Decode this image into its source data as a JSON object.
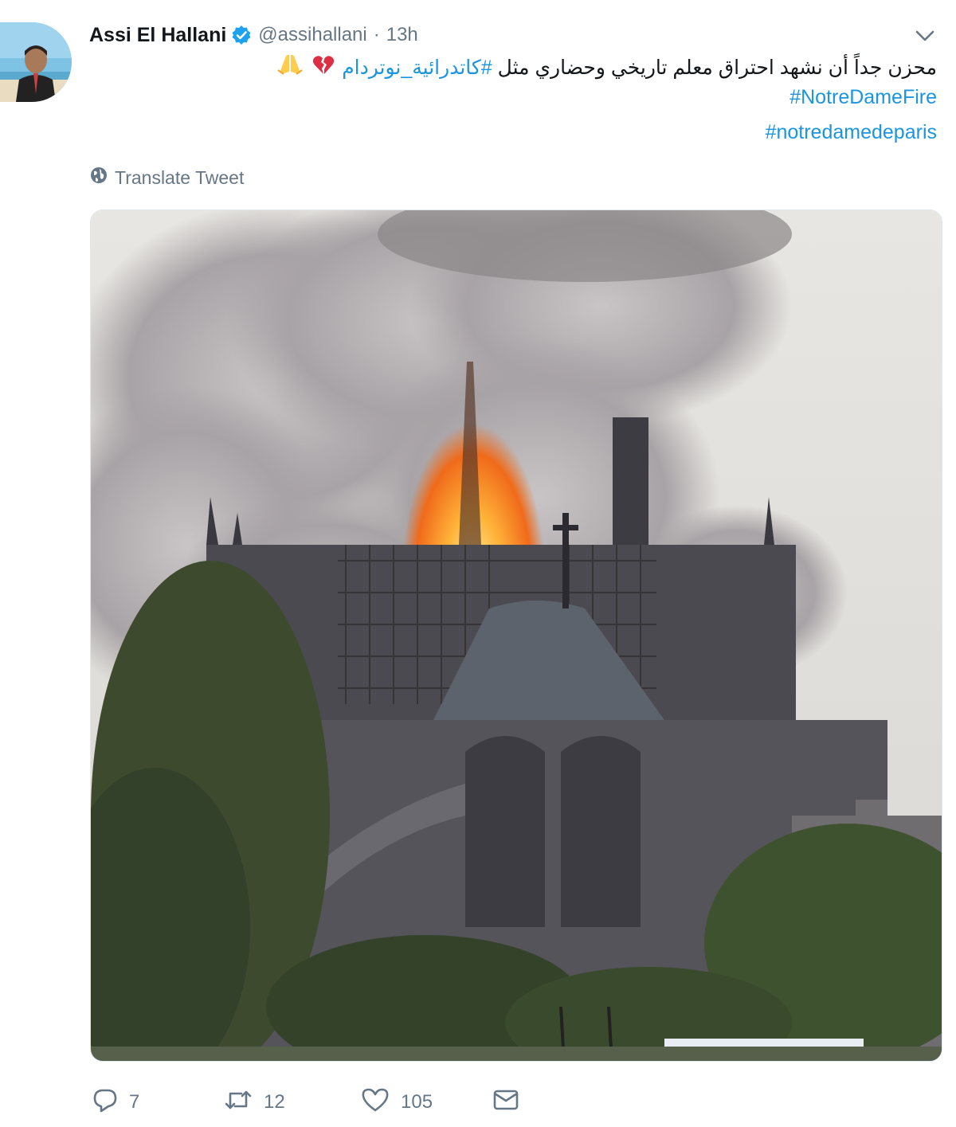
{
  "tweet": {
    "display_name": "Assi El Hallani",
    "verified": true,
    "handle": "@assihallani",
    "separator": "·",
    "time": "13h",
    "text_arabic": "محزن جداً أن نشهد احتراق معلم تاريخي وحضاري مثل",
    "hashtag_arabic": "#كاتدرائية_نوتردام",
    "emojis": [
      "broken-heart-emoji",
      "folded-hands-emoji"
    ],
    "hashtag_1": "#NotreDameFire",
    "hashtag_2": "#notredamedeparis",
    "translate_label": "Translate Tweet",
    "media_description": "photo-notre-dame-fire"
  },
  "actions": {
    "reply_count": "7",
    "retweet_count": "12",
    "like_count": "105"
  },
  "icons": {
    "verified": "verified-badge-icon",
    "caret": "chevron-down-icon",
    "globe": "globe-icon",
    "reply": "reply-icon",
    "retweet": "retweet-icon",
    "like": "heart-icon",
    "dm": "envelope-icon"
  },
  "colors": {
    "link": "#1b95e0",
    "muted": "#657786",
    "text": "#14171a"
  }
}
